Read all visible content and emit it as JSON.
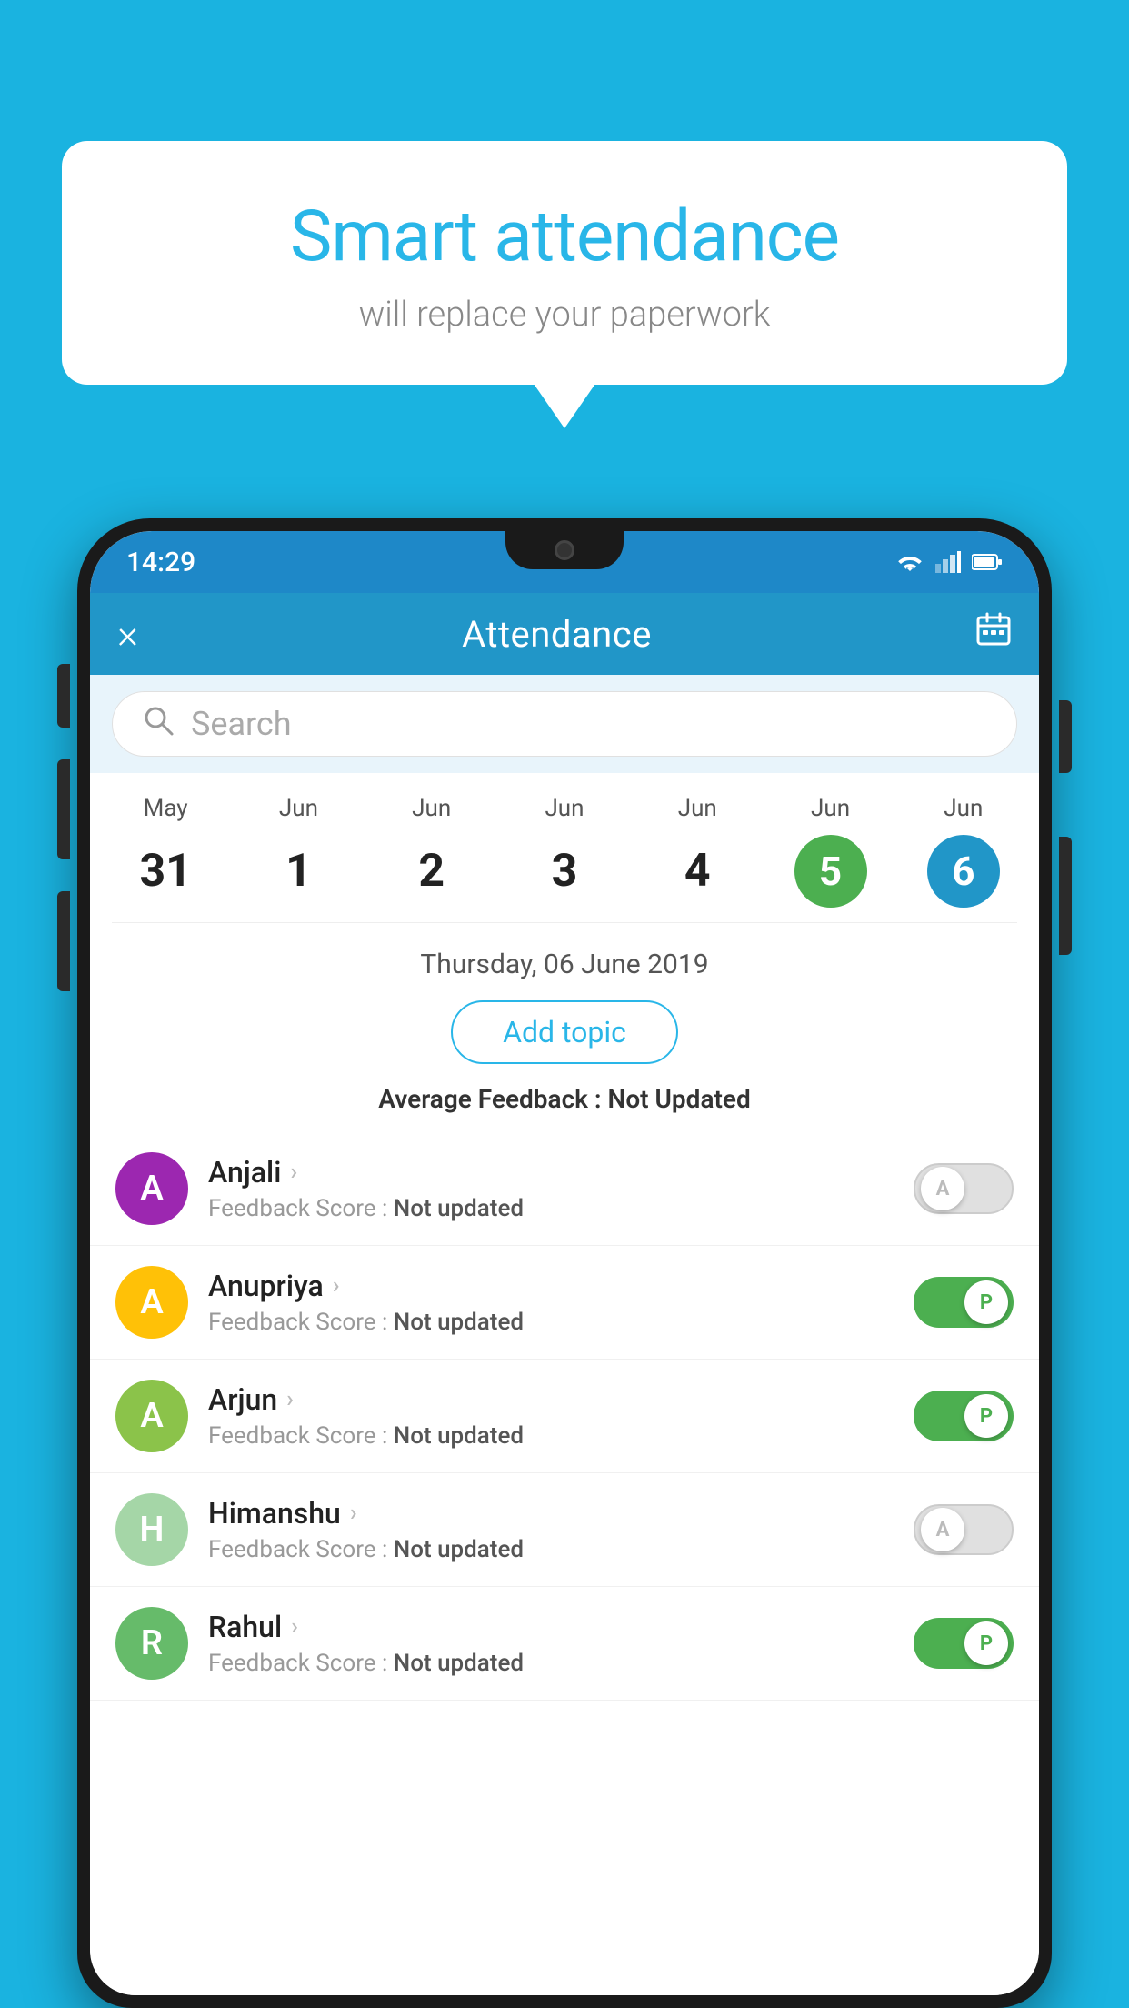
{
  "background_color": "#1ab3e0",
  "bubble": {
    "title": "Smart attendance",
    "subtitle": "will replace your paperwork"
  },
  "status_bar": {
    "time": "14:29",
    "wifi_icon": "wifi",
    "signal_icon": "signal",
    "battery_icon": "battery"
  },
  "app_bar": {
    "title": "Attendance",
    "close_label": "×",
    "calendar_icon": "calendar"
  },
  "search": {
    "placeholder": "Search"
  },
  "calendar": {
    "days": [
      {
        "month": "May",
        "date": "31",
        "state": "normal"
      },
      {
        "month": "Jun",
        "date": "1",
        "state": "normal"
      },
      {
        "month": "Jun",
        "date": "2",
        "state": "normal"
      },
      {
        "month": "Jun",
        "date": "3",
        "state": "normal"
      },
      {
        "month": "Jun",
        "date": "4",
        "state": "normal"
      },
      {
        "month": "Jun",
        "date": "5",
        "state": "today"
      },
      {
        "month": "Jun",
        "date": "6",
        "state": "selected"
      }
    ]
  },
  "date_section": {
    "selected_date": "Thursday, 06 June 2019",
    "add_topic_label": "Add topic",
    "avg_feedback_label": "Average Feedback : ",
    "avg_feedback_value": "Not Updated"
  },
  "students": [
    {
      "name": "Anjali",
      "avatar_letter": "A",
      "avatar_color": "#9c27b0",
      "feedback_label": "Feedback Score : ",
      "feedback_value": "Not updated",
      "toggle": "off",
      "toggle_letter": "A"
    },
    {
      "name": "Anupriya",
      "avatar_letter": "A",
      "avatar_color": "#ffc107",
      "feedback_label": "Feedback Score : ",
      "feedback_value": "Not updated",
      "toggle": "on",
      "toggle_letter": "P"
    },
    {
      "name": "Arjun",
      "avatar_letter": "A",
      "avatar_color": "#8bc34a",
      "feedback_label": "Feedback Score : ",
      "feedback_value": "Not updated",
      "toggle": "on",
      "toggle_letter": "P"
    },
    {
      "name": "Himanshu",
      "avatar_letter": "H",
      "avatar_color": "#a5d6a7",
      "feedback_label": "Feedback Score : ",
      "feedback_value": "Not updated",
      "toggle": "off",
      "toggle_letter": "A"
    },
    {
      "name": "Rahul",
      "avatar_letter": "R",
      "avatar_color": "#66bb6a",
      "feedback_label": "Feedback Score : ",
      "feedback_value": "Not updated",
      "toggle": "on",
      "toggle_letter": "P"
    }
  ]
}
